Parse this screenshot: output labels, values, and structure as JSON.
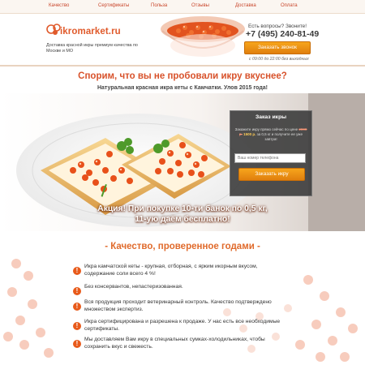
{
  "nav": {
    "items": [
      "Качество",
      "Сертификаты",
      "Польза",
      "Отзывы",
      "Доставка",
      "Оплата"
    ]
  },
  "header": {
    "logo_text": "ikromarket.ru",
    "tagline": "Доставка красной икры премиум качества по Москве и МО",
    "question": "Есть вопросы? Звоните!",
    "phone": "+7 (495) 240-81-49",
    "order_call_button": "Заказать звонок",
    "hours": "с 09:00 до 22:00 без выходных"
  },
  "hero": {
    "headline": "Спорим, что вы не пробовали икру вкуснее?",
    "subheadline": "Натуральная красная икра кеты с Камчатки. Улов 2015 года!",
    "promo_line1": "Акция! При покупке 10-ти банок по 0,5 кг,",
    "promo_line2": "11-ую даём бесплатно!"
  },
  "order_form": {
    "title": "Заказ икры",
    "desc_part1": "Закажите икру прямо сейчас по цене ",
    "old_price": "2000 р.",
    "new_price": "1500 р.",
    "desc_part2": " за 0,5 кг и получите ее уже завтра!",
    "phone_placeholder": "Ваш номер телефона",
    "submit_label": "Заказать икру"
  },
  "quality": {
    "title": "- Качество, проверенное годами -",
    "features": [
      "Икра камчатской кеты - крупная, отборная, с ярким икорным вкусом, содержание соли всего 4 %!",
      "Без консервантов, непастеризованная.",
      "Вся продукция проходит ветеринарный контроль. Качество подтверждено множеством экспертиз.",
      "Икра сертифицирована и разрешена к продаже. У нас есть все необходимые сертификаты.",
      "Мы доставляем Вам икру в специальных сумках-холодильниках, чтобы сохранить вкус и свежесть."
    ]
  },
  "colors": {
    "accent": "#d8522b",
    "button": "#f0921a",
    "dark_box": "#3c3c3c"
  }
}
